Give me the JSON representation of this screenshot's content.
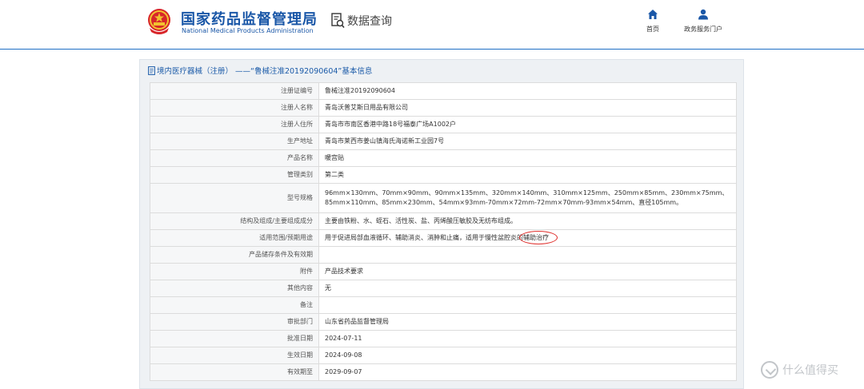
{
  "header": {
    "title_cn": "国家药品监督管理局",
    "title_en": "National Medical Products Administration",
    "query_label": "数据查询",
    "nav": [
      {
        "label": "首页",
        "icon": "home-icon"
      },
      {
        "label": "政务服务门户",
        "icon": "user-icon"
      }
    ],
    "colors": {
      "brand": "#1a57a7",
      "accent_line": "#1f6fc5"
    }
  },
  "panel": {
    "title": "境内医疗器械（注册） ——“鲁械注准20192090604”基本信息",
    "rows": [
      {
        "label": "注册证编号",
        "value": "鲁械注准20192090604"
      },
      {
        "label": "注册人名称",
        "value": "青岛沃普艾斯日用品有限公司"
      },
      {
        "label": "注册人住所",
        "value": "青岛市市南区香港中路18号福泰广场A1002户"
      },
      {
        "label": "生产地址",
        "value": "青岛市莱西市姜山镇海氏海诺新工业园7号"
      },
      {
        "label": "产品名称",
        "value": "暖宫贴"
      },
      {
        "label": "管理类别",
        "value": "第二类"
      },
      {
        "label": "型号规格",
        "value": "96mm×130mm、70mm×90mm、90mm×135mm、320mm×140mm、310mm×125mm、250mm×85mm、230mm×75mm、85mm×110mm、85mm×230mm、54mm×93mm-70mm×72mm-72mm×70mm-93mm×54mm、直径105mm。"
      },
      {
        "label": "结构及组成/主要组成成分",
        "value": "主要由铁粉、水、蛭石、活性炭、盐、丙烯酸压敏胶及无纺布组成。"
      },
      {
        "label": "适用范围/预期用途",
        "value": "用于促进局部血液循环、辅助消炎、消肿和止痛，适用于慢性盆腔炎的",
        "highlight": "辅助治疗"
      },
      {
        "label": "产品储存条件及有效期",
        "value": ""
      },
      {
        "label": "附件",
        "value": "产品技术要求"
      },
      {
        "label": "其他内容",
        "value": "无"
      },
      {
        "label": "备注",
        "value": ""
      },
      {
        "label": "审批部门",
        "value": "山东省药品监督管理局"
      },
      {
        "label": "批准日期",
        "value": "2024-07-11"
      },
      {
        "label": "生效日期",
        "value": "2024-09-08"
      },
      {
        "label": "有效期至",
        "value": "2029-09-07"
      }
    ],
    "highlight_color": "#e0322f"
  },
  "watermark": {
    "text": "什么值得买"
  }
}
